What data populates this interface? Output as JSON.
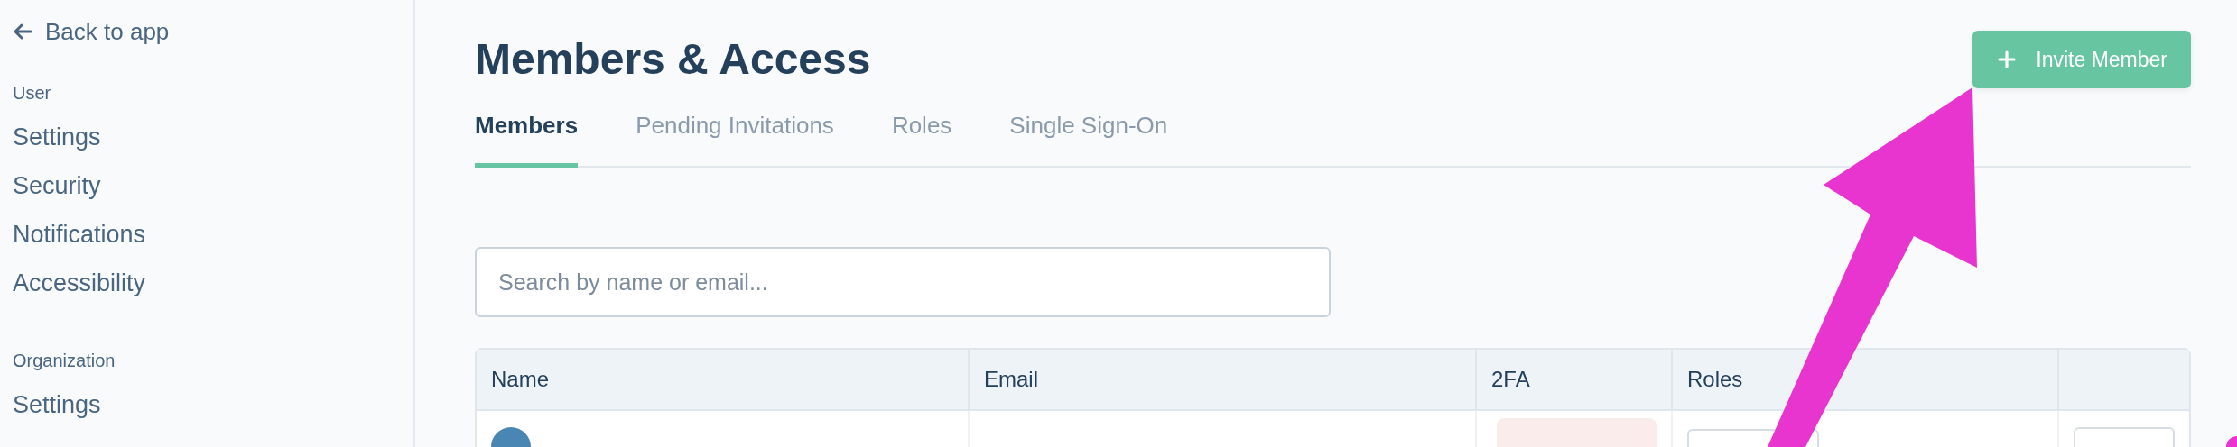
{
  "sidebar": {
    "back_link": "Back to app",
    "sections": [
      {
        "heading": "User",
        "items": [
          "Settings",
          "Security",
          "Notifications",
          "Accessibility"
        ]
      },
      {
        "heading": "Organization",
        "items": [
          "Settings"
        ]
      }
    ]
  },
  "page": {
    "title": "Members & Access",
    "primary_button": "Invite Member"
  },
  "tabs": [
    {
      "label": "Members",
      "selected": true
    },
    {
      "label": "Pending Invitations",
      "selected": false
    },
    {
      "label": "Roles",
      "selected": false
    },
    {
      "label": "Single Sign-On",
      "selected": false
    }
  ],
  "search": {
    "placeholder": "Search by name or email..."
  },
  "table": {
    "columns": [
      "Name",
      "Email",
      "2FA",
      "Roles",
      ""
    ]
  }
}
